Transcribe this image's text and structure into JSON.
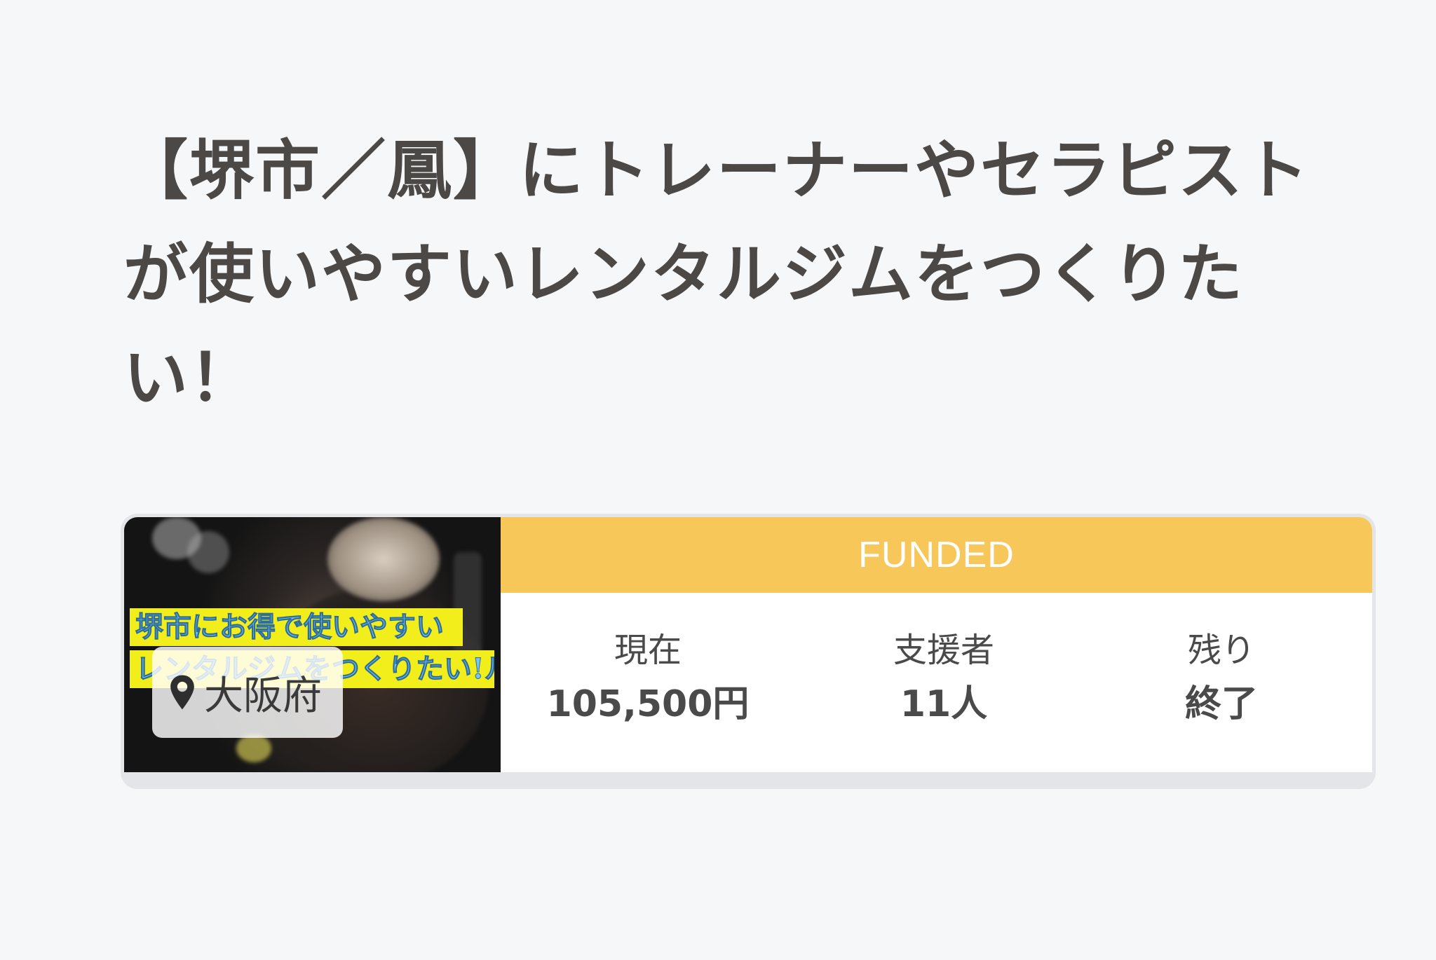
{
  "project": {
    "title": "【堺市／鳳】にトレーナーやセラピストが使いやすいレンタルジムをつくりたい！",
    "thumbnail": {
      "banner_line1": "堺市にお得で使いやすい",
      "banner_line2": "レンタルジムをつくりたい!ルジムを!",
      "location": "大阪府",
      "location_icon": "map-pin-icon"
    },
    "status": "FUNDED",
    "status_color": "#f8c75a",
    "stats": {
      "raised_label": "現在",
      "raised_value": "105,500円",
      "backers_label": "支援者",
      "backers_value": "11人",
      "remaining_label": "残り",
      "remaining_value": "終了"
    }
  }
}
